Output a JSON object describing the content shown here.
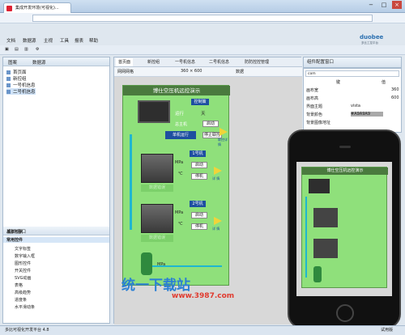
{
  "browser": {
    "tab_title": "集成开发环境(可视化)...",
    "window_controls": [
      "−",
      "□",
      "×"
    ]
  },
  "menu": {
    "items": [
      "文档",
      "数据源",
      "主视",
      "工具",
      "报表",
      "帮助"
    ]
  },
  "toolbar": {
    "items": [
      "首页面",
      "新控组",
      "二号机信息",
      "二号机信息",
      "防防控控管理"
    ]
  },
  "logo": {
    "text": "duobee",
    "sub": "多比工控平台"
  },
  "left": {
    "tabs": [
      "图案",
      "数据源"
    ],
    "tree": [
      "首页面",
      "新控组",
      "一号机信息",
      "二号机信息"
    ],
    "toolbox_title": "组件窗口",
    "groups": [
      "基本形状",
      "常用控件"
    ],
    "controls": [
      "文字标签",
      "数字输入框",
      "图形控件",
      "开关控件",
      "SVG动画",
      "表格",
      "高级趋势",
      "进度条",
      "水平滑动条"
    ]
  },
  "editor": {
    "doctabs": [
      "首页面",
      "新控组",
      "一号机信息",
      "二号机信息",
      "防防控控管理"
    ],
    "subtool": [
      "网网网格",
      "360 × 600",
      "数据"
    ],
    "scada": {
      "title": "博仕空压机远控演示",
      "ctrl_label": "控制策",
      "run_label": "运行",
      "day": "天",
      "main_unit": "总主机",
      "main_btn": "启动",
      "stop_btn": "停止",
      "unit_run": "单机运行",
      "stop_all": "停止联控",
      "m1_title": "1号机",
      "m1_start": "启动",
      "m1_stop": "停机",
      "mpa": "MPa",
      "deg": "℃",
      "err1": "数据错误",
      "m2_title": "2号机",
      "m2_start": "启动",
      "m2_stop": "停机",
      "err2": "数据错误",
      "tank": "MPa",
      "detail": "详 情",
      "link": "联控详情"
    }
  },
  "right": {
    "title": "组件配置窗口",
    "search": "com",
    "headers": [
      "键",
      "值"
    ],
    "rows": [
      [
        "画布宽",
        "360"
      ],
      [
        "画布高",
        "600"
      ],
      [
        "界面主题",
        "vista"
      ],
      [
        "背景颜色",
        "#A9A9A9"
      ],
      [
        "背景图像地址",
        ""
      ]
    ]
  },
  "phone": {
    "title": "博仕空压机远控演示"
  },
  "status": {
    "text": "多比可视化开发平台 4.8",
    "right": "试用版"
  },
  "watermark": {
    "cn": "统一下载站",
    "url": "www.3987.com"
  }
}
